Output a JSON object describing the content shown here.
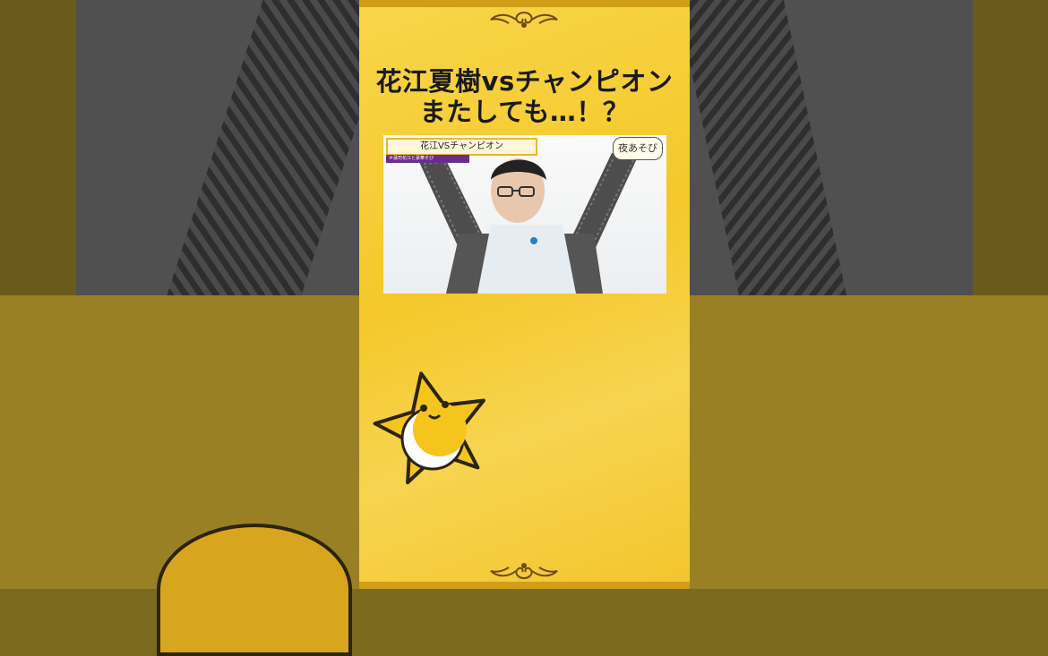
{
  "title": {
    "line1": "花江夏樹vsチャンピオン",
    "line2": "またしても…！？"
  },
  "video": {
    "caption": "花江VSチャンピオン",
    "caption_sub": "＃蓮司花江と豪華そび",
    "logo": "夜あそび"
  },
  "colors": {
    "panel_yellow": "#f4c82a",
    "frame_gold": "#d19e18",
    "caption_purple": "#6b2c8e"
  },
  "icons": {
    "ornament": "flourish-ornament-icon",
    "mascot": "star-moon-mascot-icon"
  }
}
